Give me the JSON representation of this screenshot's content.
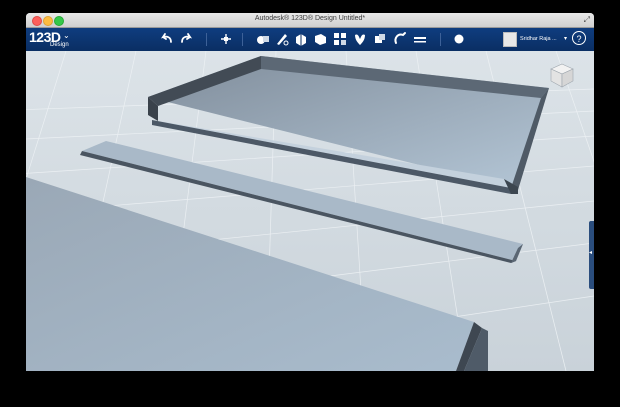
{
  "window": {
    "title": "Autodesk® 123D® Design  Untitled*"
  },
  "app": {
    "logo": "123D",
    "logo_sub": "Design",
    "logo_caret": "⌄"
  },
  "toolbar": {
    "tools": [
      "undo-icon",
      "redo-icon",
      "transform-icon",
      "primitives-icon",
      "sketch-icon",
      "construct-icon",
      "modify-icon",
      "pattern-icon",
      "grouping-icon",
      "combine-icon",
      "measure-icon",
      "text-icon",
      "material-icon"
    ]
  },
  "user": {
    "name": "Sridhar Raja ...",
    "caret": "▾"
  },
  "help": {
    "label": "?"
  },
  "colors": {
    "toolbar_bg": "#0a2e63",
    "grid_bg": "#d3dbe1",
    "solid_top": "#a7b8c8",
    "solid_side": "#4c5866"
  }
}
